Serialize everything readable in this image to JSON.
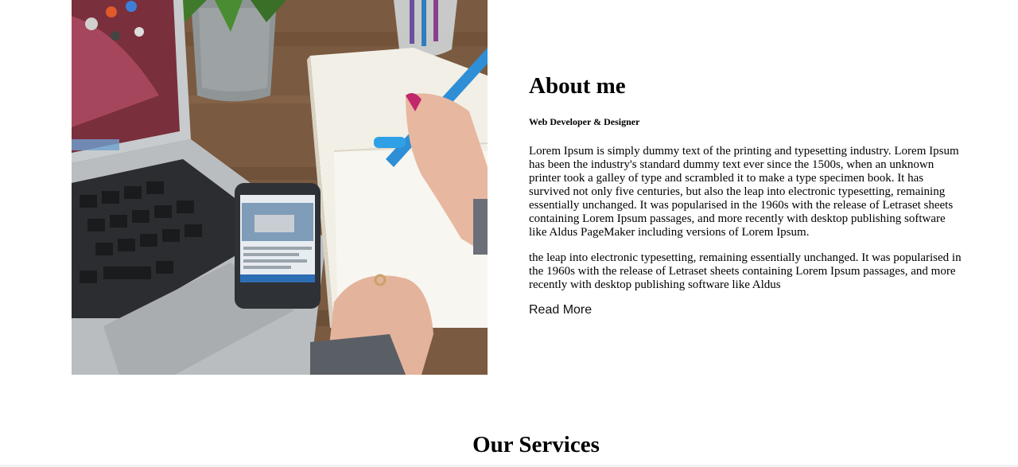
{
  "about": {
    "heading": "About me",
    "subheading": "Web Developer & Designer",
    "paragraph1": "Lorem Ipsum is simply dummy text of the printing and typesetting industry. Lorem Ipsum has been the industry's standard dummy text ever since the 1500s, when an unknown printer took a galley of type and scrambled it to make a type specimen book. It has survived not only five centuries, but also the leap into electronic typesetting, remaining essentially unchanged. It was popularised in the 1960s with the release of Letraset sheets containing Lorem Ipsum passages, and more recently with desktop publishing software like Aldus PageMaker including versions of Lorem Ipsum.",
    "paragraph2": "the leap into electronic typesetting, remaining essentially unchanged. It was popularised in the 1960s with the release of Letraset sheets containing Lorem Ipsum passages, and more recently with desktop publishing software like Aldus",
    "read_more_label": "Read More"
  },
  "services": {
    "heading": "Our Services"
  },
  "photo": {
    "alt": "Person writing in a notebook next to a laptop and smartphone on a wooden desk"
  }
}
